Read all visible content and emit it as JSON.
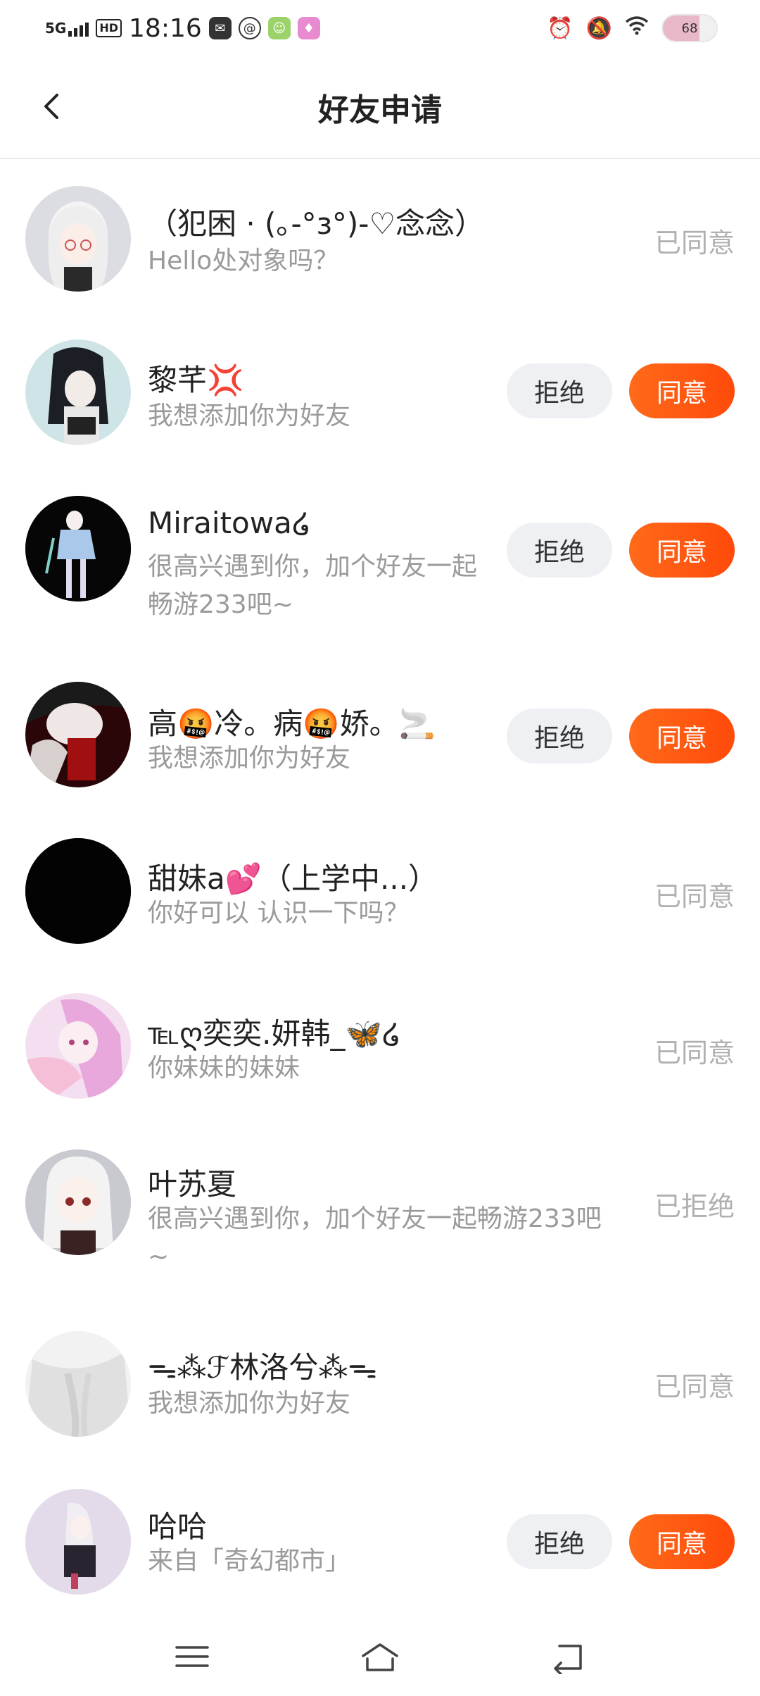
{
  "status_bar": {
    "network": "5G",
    "hd": "HD",
    "time": "18:16",
    "battery_level": "68",
    "battery_fraction": 0.68
  },
  "header": {
    "title": "好友申请"
  },
  "requests": [
    {
      "name": "（犯困 · (｡-°з°)-♡念念）",
      "message": "Hello处对象吗？",
      "status": "已同意"
    },
    {
      "name": "黎芊💢",
      "message": "我想添加你为好友",
      "actions": {
        "reject": "拒绝",
        "accept": "同意"
      }
    },
    {
      "name": "Miraitowa໒",
      "message": "很高兴遇到你，加个好友一起畅游233吧~",
      "actions": {
        "reject": "拒绝",
        "accept": "同意"
      }
    },
    {
      "name": "高🤬冷。病🤬娇。🚬",
      "message": "我想添加你为好友",
      "actions": {
        "reject": "拒绝",
        "accept": "同意"
      }
    },
    {
      "name": "甜妹a💕（上学中...）",
      "message": "你好可以 认识一下吗？",
      "status": "已同意"
    },
    {
      "name": "℡ღ奕奕.妍韩_🦋໒",
      "message": "你妹妹的妹妹",
      "status": "已同意"
    },
    {
      "name": "叶苏夏",
      "message": "很高兴遇到你，加个好友一起畅游233吧~",
      "status": "已拒绝"
    },
    {
      "name": "ᯓ⁂ℱ林洛兮⁂ᯓ",
      "message": "我想添加你为好友",
      "status": "已同意"
    },
    {
      "name": "哈哈",
      "message": "来自「奇幻都市」",
      "actions": {
        "reject": "拒绝",
        "accept": "同意"
      }
    }
  ],
  "colors": {
    "accent": "#ff5a12",
    "reject_bg": "#eef0f4",
    "muted_text": "#9a9a9a",
    "status_text": "#b0b0b0"
  },
  "icons": {
    "back": "chevron-left-icon",
    "nav_menu": "menu-icon",
    "nav_home": "home-icon",
    "nav_back": "return-icon"
  }
}
